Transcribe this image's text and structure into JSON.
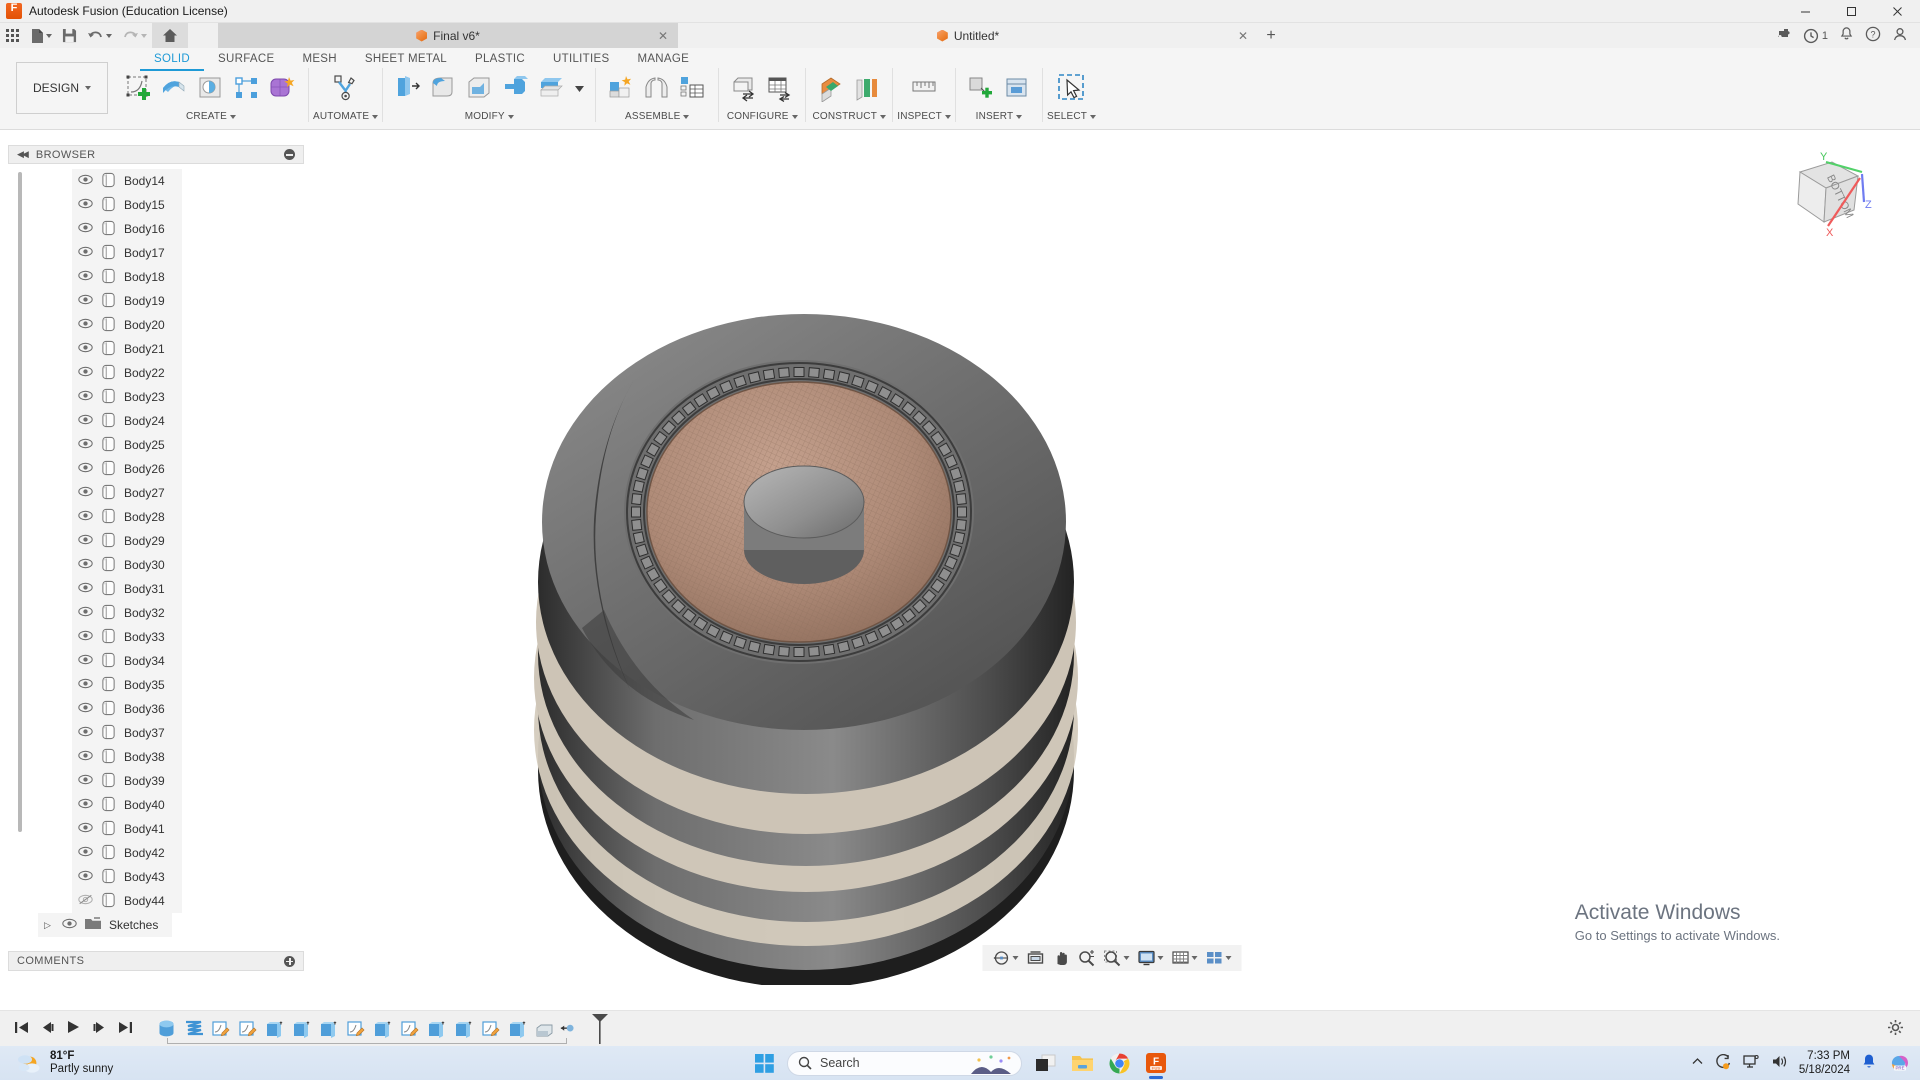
{
  "window": {
    "title": "Autodesk Fusion (Education License)",
    "logo_icon": "fusion-logo-icon",
    "controls": {
      "minimize": "–",
      "maximize": "☐",
      "close": "✕"
    }
  },
  "quick_access": {
    "items": [
      {
        "name": "app-grid",
        "icon": "grid-icon"
      },
      {
        "name": "new-file",
        "icon": "file-icon",
        "has_caret": true
      },
      {
        "name": "save",
        "icon": "save-icon"
      },
      {
        "name": "undo",
        "icon": "undo-icon",
        "has_caret": true
      },
      {
        "name": "redo",
        "icon": "redo-icon",
        "has_caret": true
      },
      {
        "name": "home",
        "icon": "home-icon"
      }
    ],
    "right_icons": [
      {
        "name": "extension-manager",
        "icon": "puzzle-icon"
      },
      {
        "name": "job-status",
        "icon": "clock-icon",
        "badge": "1"
      },
      {
        "name": "notifications",
        "icon": "bell-icon"
      },
      {
        "name": "help",
        "icon": "question-icon"
      },
      {
        "name": "account",
        "icon": "user-icon"
      }
    ]
  },
  "document_tabs": [
    {
      "label": "Final v6*",
      "icon": "cube-icon",
      "active": true,
      "closable": true
    },
    {
      "label": "Untitled*",
      "icon": "cube-icon",
      "active": false,
      "closable": true
    }
  ],
  "new_tab_label": "+",
  "ribbon": {
    "workspace_label": "DESIGN",
    "tabs": [
      {
        "label": "SOLID",
        "active": true
      },
      {
        "label": "SURFACE",
        "active": false
      },
      {
        "label": "MESH",
        "active": false
      },
      {
        "label": "SHEET METAL",
        "active": false
      },
      {
        "label": "PLASTIC",
        "active": false
      },
      {
        "label": "UTILITIES",
        "active": false
      },
      {
        "label": "MANAGE",
        "active": false
      }
    ],
    "panels": [
      {
        "label": "CREATE",
        "icons": [
          "create-sketch-icon",
          "extrude-icon",
          "revolve-icon",
          "pattern-icon",
          "form-icon"
        ]
      },
      {
        "label": "AUTOMATE",
        "icons": [
          "automated-modeling-icon"
        ]
      },
      {
        "label": "MODIFY",
        "icons": [
          "press-pull-icon",
          "fillet-icon",
          "shell-icon",
          "combine-icon",
          "offset-face-icon",
          "modify-more-icon"
        ]
      },
      {
        "label": "ASSEMBLE",
        "icons": [
          "new-component-icon",
          "joint-icon",
          "assemble-table-icon"
        ]
      },
      {
        "label": "CONFIGURE",
        "icons": [
          "configure-model-icon",
          "configure-table-icon"
        ]
      },
      {
        "label": "CONSTRUCT",
        "icons": [
          "offset-plane-icon",
          "plane-angle-icon"
        ]
      },
      {
        "label": "INSPECT",
        "icons": [
          "measure-icon"
        ]
      },
      {
        "label": "INSERT",
        "icons": [
          "insert-derive-icon",
          "insert-mcmaster-icon"
        ]
      },
      {
        "label": "SELECT",
        "icons": [
          "select-icon"
        ]
      }
    ]
  },
  "browser": {
    "title": "BROWSER",
    "collapse_icon": "collapse-left-icon",
    "minimize_icon": "minus-circle-icon",
    "nodes": [
      {
        "label": "Body14",
        "visible": true
      },
      {
        "label": "Body15",
        "visible": true
      },
      {
        "label": "Body16",
        "visible": true
      },
      {
        "label": "Body17",
        "visible": true
      },
      {
        "label": "Body18",
        "visible": true
      },
      {
        "label": "Body19",
        "visible": true
      },
      {
        "label": "Body20",
        "visible": true
      },
      {
        "label": "Body21",
        "visible": true
      },
      {
        "label": "Body22",
        "visible": true
      },
      {
        "label": "Body23",
        "visible": true
      },
      {
        "label": "Body24",
        "visible": true
      },
      {
        "label": "Body25",
        "visible": true
      },
      {
        "label": "Body26",
        "visible": true
      },
      {
        "label": "Body27",
        "visible": true
      },
      {
        "label": "Body28",
        "visible": true
      },
      {
        "label": "Body29",
        "visible": true
      },
      {
        "label": "Body30",
        "visible": true
      },
      {
        "label": "Body31",
        "visible": true
      },
      {
        "label": "Body32",
        "visible": true
      },
      {
        "label": "Body33",
        "visible": true
      },
      {
        "label": "Body34",
        "visible": true
      },
      {
        "label": "Body35",
        "visible": true
      },
      {
        "label": "Body36",
        "visible": true
      },
      {
        "label": "Body37",
        "visible": true
      },
      {
        "label": "Body38",
        "visible": true
      },
      {
        "label": "Body39",
        "visible": true
      },
      {
        "label": "Body40",
        "visible": true
      },
      {
        "label": "Body41",
        "visible": true
      },
      {
        "label": "Body42",
        "visible": true
      },
      {
        "label": "Body43",
        "visible": true
      },
      {
        "label": "Body44",
        "visible": false
      }
    ],
    "sketches_node": {
      "label": "Sketches",
      "visible": true,
      "expander": "▷",
      "icon": "folder-icon"
    }
  },
  "comments": {
    "title": "COMMENTS",
    "add_icon": "plus-circle-icon"
  },
  "canvas": {
    "viewcube": {
      "face_label": "BOTTOM",
      "axis_x": "X",
      "axis_y": "Y",
      "axis_z": "Z"
    },
    "watermark": {
      "line1": "Activate Windows",
      "line2": "Go to Settings to activate Windows."
    },
    "navbar_items": [
      {
        "name": "orbit-icon",
        "caret": true
      },
      {
        "name": "fit-icon",
        "caret": false
      },
      {
        "name": "pan-icon",
        "caret": false
      },
      {
        "name": "zoom-icon",
        "caret": false
      },
      {
        "name": "zoom-window-icon",
        "caret": true
      },
      {
        "name": "display-settings-icon",
        "caret": true
      },
      {
        "name": "grid-settings-icon",
        "caret": true
      },
      {
        "name": "viewports-icon",
        "caret": true
      }
    ]
  },
  "timeline": {
    "playback": [
      "go-to-beginning-icon",
      "step-back-icon",
      "play-icon",
      "step-forward-icon",
      "go-to-end-icon"
    ],
    "features": [
      "cylinder-feature-icon",
      "coil-feature-icon",
      "sketch-feature-icon",
      "sketch-feature-icon",
      "extrude-feature-icon",
      "extrude-feature-icon",
      "extrude-feature-icon",
      "sketch-feature-icon",
      "extrude-feature-icon",
      "sketch-feature-icon",
      "extrude-feature-icon",
      "extrude-feature-icon",
      "sketch-feature-icon",
      "extrude-feature-icon",
      "shell-feature-icon"
    ],
    "end_marker": "timeline-marker-icon",
    "settings_icon": "gear-icon"
  },
  "taskbar": {
    "weather": {
      "temperature": "81°F",
      "condition": "Partly sunny",
      "icon": "partly-sunny-icon"
    },
    "start_icon": "windows-start-icon",
    "search": {
      "placeholder": "Search",
      "icon": "search-icon"
    },
    "apps": [
      {
        "name": "task-view-icon",
        "active": false
      },
      {
        "name": "file-explorer-icon",
        "active": false
      },
      {
        "name": "chrome-icon",
        "active": false
      },
      {
        "name": "fusion-taskbar-icon",
        "active": true
      }
    ],
    "tray": {
      "overflow_icon": "chevron-up-icon",
      "icons": [
        "onedrive-sync-icon",
        "network-icon",
        "volume-icon"
      ],
      "time": "7:33 PM",
      "date": "5/18/2024",
      "notification_icon": "bell-icon",
      "copilot_icon": "copilot-icon"
    }
  },
  "colors": {
    "accent": "#1e9ad6",
    "brand_orange": "#e35205",
    "ribbon_bg": "#f5f5f5",
    "panel_bg": "#f0f0f0",
    "model_body": "#6d6d6d",
    "model_copper": "#b08d7c"
  }
}
